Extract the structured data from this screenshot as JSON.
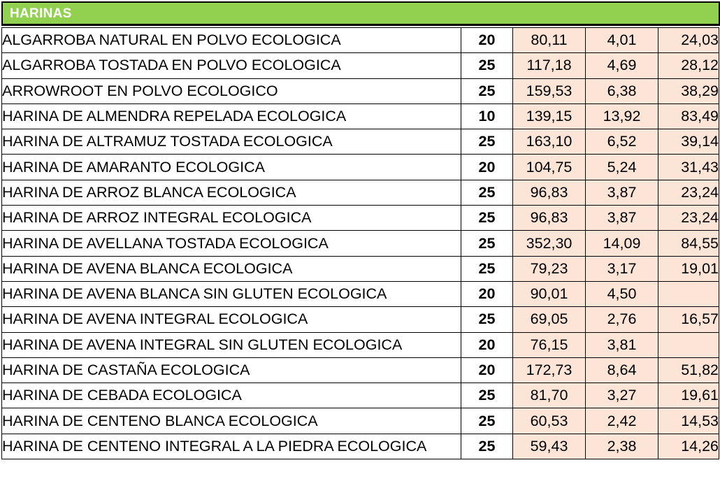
{
  "section_title": "HARINAS",
  "rows": [
    {
      "name": "ALGARROBA NATURAL EN POLVO ECOLOGICA",
      "qty": "20",
      "p1": "80,11",
      "p2": "4,01",
      "p3": "24,03"
    },
    {
      "name": "ALGARROBA TOSTADA EN POLVO ECOLOGICA",
      "qty": "25",
      "p1": "117,18",
      "p2": "4,69",
      "p3": "28,12"
    },
    {
      "name": "ARROWROOT EN POLVO ECOLOGICO",
      "qty": "25",
      "p1": "159,53",
      "p2": "6,38",
      "p3": "38,29"
    },
    {
      "name": "HARINA DE ALMENDRA REPELADA ECOLOGICA",
      "qty": "10",
      "p1": "139,15",
      "p2": "13,92",
      "p3": "83,49"
    },
    {
      "name": "HARINA DE ALTRAMUZ TOSTADA ECOLOGICA",
      "qty": "25",
      "p1": "163,10",
      "p2": "6,52",
      "p3": "39,14"
    },
    {
      "name": "HARINA DE AMARANTO ECOLOGICA",
      "qty": "20",
      "p1": "104,75",
      "p2": "5,24",
      "p3": "31,43"
    },
    {
      "name": "HARINA DE ARROZ BLANCA ECOLOGICA",
      "qty": "25",
      "p1": "96,83",
      "p2": "3,87",
      "p3": "23,24"
    },
    {
      "name": "HARINA DE ARROZ INTEGRAL ECOLOGICA",
      "qty": "25",
      "p1": "96,83",
      "p2": "3,87",
      "p3": "23,24"
    },
    {
      "name": "HARINA DE AVELLANA TOSTADA ECOLOGICA",
      "qty": "25",
      "p1": "352,30",
      "p2": "14,09",
      "p3": "84,55"
    },
    {
      "name": "HARINA DE AVENA BLANCA ECOLOGICA",
      "qty": "25",
      "p1": "79,23",
      "p2": "3,17",
      "p3": "19,01"
    },
    {
      "name": "HARINA DE AVENA BLANCA SIN GLUTEN ECOLOGICA",
      "qty": "20",
      "p1": "90,01",
      "p2": "4,50",
      "p3": ""
    },
    {
      "name": "HARINA DE AVENA INTEGRAL ECOLOGICA",
      "qty": "25",
      "p1": "69,05",
      "p2": "2,76",
      "p3": "16,57"
    },
    {
      "name": "HARINA DE AVENA INTEGRAL SIN GLUTEN ECOLOGICA",
      "qty": "20",
      "p1": "76,15",
      "p2": "3,81",
      "p3": ""
    },
    {
      "name": "HARINA DE CASTAÑA ECOLOGICA",
      "qty": "20",
      "p1": "172,73",
      "p2": "8,64",
      "p3": "51,82"
    },
    {
      "name": "HARINA DE CEBADA ECOLOGICA",
      "qty": "25",
      "p1": "81,70",
      "p2": "3,27",
      "p3": "19,61"
    },
    {
      "name": "HARINA DE CENTENO BLANCA ECOLOGICA",
      "qty": "25",
      "p1": "60,53",
      "p2": "2,42",
      "p3": "14,53"
    },
    {
      "name": "HARINA DE CENTENO INTEGRAL A LA PIEDRA ECOLOGICA",
      "qty": "25",
      "p1": "59,43",
      "p2": "2,38",
      "p3": "14,26"
    }
  ],
  "colors": {
    "header_bg": "#92d050",
    "header_text": "#ffffff",
    "price_bg": "#fce4d6"
  }
}
